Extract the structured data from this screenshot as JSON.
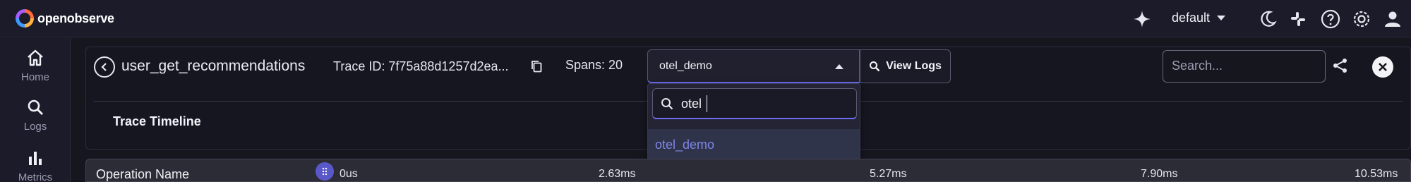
{
  "app": {
    "logo_text": "openobserve"
  },
  "header": {
    "org": "default",
    "icons": [
      "sparkle-icon",
      "org-caret-icon",
      "moon-icon",
      "slack-icon",
      "help-icon",
      "settings-icon",
      "user-icon"
    ]
  },
  "nav": {
    "items": [
      {
        "label": "Home",
        "icon": "home-icon"
      },
      {
        "label": "Logs",
        "icon": "search-icon"
      },
      {
        "label": "Metrics",
        "icon": "bar-chart-icon"
      }
    ]
  },
  "trace": {
    "service_name": "user_get_recommendations",
    "trace_id_text": "Trace ID: 7f75a88d1257d2ea...",
    "spans_text": "Spans: 20",
    "stream_value": "otel_demo",
    "view_logs_label": "View Logs",
    "search_placeholder": "Search...",
    "timeline_title": "Trace Timeline"
  },
  "dropdown": {
    "query": "otel",
    "options": [
      "otel_demo"
    ]
  },
  "timeline": {
    "column_label": "Operation Name",
    "ticks": [
      "0us",
      "2.63ms",
      "5.27ms",
      "7.90ms",
      "10.53ms"
    ]
  },
  "colors": {
    "accent": "#6c6cf0",
    "option_text": "#7e86e8",
    "background": "#16161f"
  }
}
